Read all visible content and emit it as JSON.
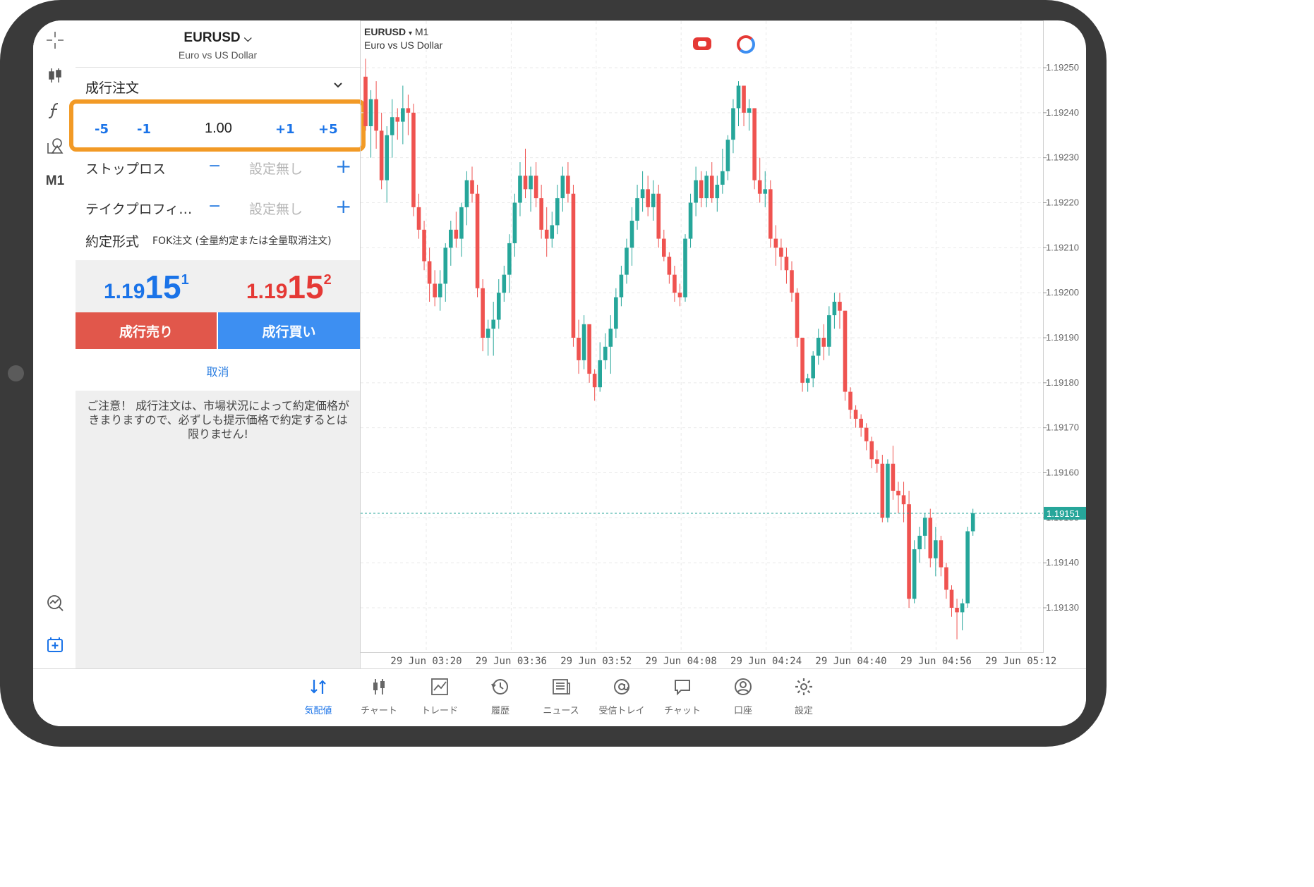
{
  "symbol": {
    "name": "EURUSD",
    "description": "Euro vs US Dollar"
  },
  "order": {
    "type": "成行注文",
    "volume": {
      "value": "1.00",
      "minus5": "-5",
      "minus1": "-1",
      "plus1": "+1",
      "plus5": "+5"
    },
    "stop_loss": {
      "label": "ストップロス",
      "minus": "−",
      "value": "設定無し",
      "plus": "+"
    },
    "take_profit": {
      "label": "テイクプロフィ…",
      "minus": "−",
      "value": "設定無し",
      "plus": "+"
    },
    "execution": {
      "label": "約定形式",
      "value": "FOK注文 (全量約定または全量取消注文)"
    },
    "bid": {
      "small": "1.19",
      "big": "15",
      "sup": "1"
    },
    "ask": {
      "small": "1.19",
      "big": "15",
      "sup": "2"
    },
    "sell_label": "成行売り",
    "buy_label": "成行買い",
    "cancel_label": "取消",
    "warning": "ご注意！ 成行注文は、市場状況によって約定価格がきまりますので、必ずしも提示価格で約定するとは限りません!"
  },
  "toolbar": {
    "timeframe": "M1"
  },
  "chart_header": {
    "symbol": "EURUSD",
    "arrow": "▾",
    "timeframe": "M1",
    "description": "Euro vs US Dollar"
  },
  "chart_data": {
    "type": "candlestick",
    "symbol": "EURUSD",
    "timeframe": "M1",
    "current_price": 1.19151,
    "current_price_label": "1.19151",
    "ylim": [
      1.19125,
      1.19253
    ],
    "y_ticks": [
      "1.19250",
      "1.19240",
      "1.19230",
      "1.19220",
      "1.19210",
      "1.19200",
      "1.19190",
      "1.19180",
      "1.19170",
      "1.19160",
      "1.19150",
      "1.19140",
      "1.19130"
    ],
    "x_ticks": [
      "29 Jun 03:20",
      "29 Jun 03:36",
      "29 Jun 03:52",
      "29 Jun 04:08",
      "29 Jun 04:24",
      "29 Jun 04:40",
      "29 Jun 04:56",
      "29 Jun 05:12"
    ],
    "grid": true,
    "colors": {
      "up": "#26a69a",
      "down": "#ef5350",
      "price_line": "#26a69a"
    },
    "ohlc": [
      [
        1.19248,
        1.19252,
        1.19236,
        1.19237
      ],
      [
        1.19237,
        1.19245,
        1.1923,
        1.19243
      ],
      [
        1.19243,
        1.19247,
        1.19232,
        1.19236
      ],
      [
        1.19236,
        1.1924,
        1.19223,
        1.19225
      ],
      [
        1.19225,
        1.19237,
        1.1922,
        1.19235
      ],
      [
        1.19235,
        1.19243,
        1.1923,
        1.19239
      ],
      [
        1.19239,
        1.19241,
        1.19234,
        1.19238
      ],
      [
        1.19238,
        1.19246,
        1.19233,
        1.19241
      ],
      [
        1.19241,
        1.19244,
        1.19235,
        1.1924
      ],
      [
        1.1924,
        1.19242,
        1.19217,
        1.19219
      ],
      [
        1.19219,
        1.19222,
        1.19212,
        1.19214
      ],
      [
        1.19214,
        1.19216,
        1.19205,
        1.19207
      ],
      [
        1.19207,
        1.1921,
        1.19198,
        1.19202
      ],
      [
        1.19202,
        1.19205,
        1.19197,
        1.19199
      ],
      [
        1.19199,
        1.19205,
        1.19196,
        1.19202
      ],
      [
        1.19202,
        1.19211,
        1.19198,
        1.1921
      ],
      [
        1.1921,
        1.19216,
        1.19206,
        1.19214
      ],
      [
        1.19214,
        1.19218,
        1.1921,
        1.19212
      ],
      [
        1.19212,
        1.1922,
        1.19208,
        1.19219
      ],
      [
        1.19219,
        1.19227,
        1.19215,
        1.19225
      ],
      [
        1.19225,
        1.19228,
        1.1922,
        1.19222
      ],
      [
        1.19222,
        1.19224,
        1.19199,
        1.19201
      ],
      [
        1.19201,
        1.19203,
        1.19187,
        1.1919
      ],
      [
        1.1919,
        1.19194,
        1.19186,
        1.19192
      ],
      [
        1.19192,
        1.19198,
        1.19186,
        1.19194
      ],
      [
        1.19194,
        1.19203,
        1.19192,
        1.192
      ],
      [
        1.192,
        1.19206,
        1.19198,
        1.19204
      ],
      [
        1.19204,
        1.19213,
        1.192,
        1.19211
      ],
      [
        1.19211,
        1.19222,
        1.19208,
        1.1922
      ],
      [
        1.1922,
        1.19229,
        1.19217,
        1.19226
      ],
      [
        1.19226,
        1.19232,
        1.19221,
        1.19223
      ],
      [
        1.19223,
        1.19228,
        1.19218,
        1.19226
      ],
      [
        1.19226,
        1.19229,
        1.19219,
        1.19221
      ],
      [
        1.19221,
        1.19224,
        1.19212,
        1.19214
      ],
      [
        1.19214,
        1.19219,
        1.19208,
        1.19212
      ],
      [
        1.19212,
        1.19218,
        1.1921,
        1.19215
      ],
      [
        1.19215,
        1.19224,
        1.19213,
        1.19221
      ],
      [
        1.19221,
        1.19228,
        1.19218,
        1.19226
      ],
      [
        1.19226,
        1.19229,
        1.1922,
        1.19222
      ],
      [
        1.19222,
        1.19224,
        1.19188,
        1.1919
      ],
      [
        1.1919,
        1.19194,
        1.19182,
        1.19185
      ],
      [
        1.19185,
        1.19195,
        1.19183,
        1.19193
      ],
      [
        1.19193,
        1.19193,
        1.1918,
        1.19182
      ],
      [
        1.19182,
        1.19183,
        1.19176,
        1.19179
      ],
      [
        1.19179,
        1.19189,
        1.19178,
        1.19185
      ],
      [
        1.19185,
        1.19191,
        1.19183,
        1.19188
      ],
      [
        1.19188,
        1.19195,
        1.19182,
        1.19192
      ],
      [
        1.19192,
        1.19201,
        1.1919,
        1.19199
      ],
      [
        1.19199,
        1.19206,
        1.19197,
        1.19204
      ],
      [
        1.19204,
        1.19212,
        1.19202,
        1.1921
      ],
      [
        1.1921,
        1.19219,
        1.19206,
        1.19216
      ],
      [
        1.19216,
        1.19224,
        1.19214,
        1.19221
      ],
      [
        1.19221,
        1.19227,
        1.19218,
        1.19223
      ],
      [
        1.19223,
        1.19226,
        1.19217,
        1.19219
      ],
      [
        1.19219,
        1.19225,
        1.19216,
        1.19222
      ],
      [
        1.19222,
        1.19224,
        1.1921,
        1.19212
      ],
      [
        1.19212,
        1.19214,
        1.19207,
        1.19208
      ],
      [
        1.19208,
        1.19209,
        1.19202,
        1.19204
      ],
      [
        1.19204,
        1.19206,
        1.19198,
        1.192
      ],
      [
        1.192,
        1.19202,
        1.19197,
        1.19199
      ],
      [
        1.19199,
        1.19213,
        1.19198,
        1.19212
      ],
      [
        1.19212,
        1.19222,
        1.1921,
        1.1922
      ],
      [
        1.1922,
        1.19228,
        1.19217,
        1.19225
      ],
      [
        1.19225,
        1.19227,
        1.19219,
        1.19221
      ],
      [
        1.19221,
        1.19227,
        1.19219,
        1.19226
      ],
      [
        1.19226,
        1.19229,
        1.1922,
        1.19221
      ],
      [
        1.19221,
        1.19226,
        1.19218,
        1.19224
      ],
      [
        1.19224,
        1.19232,
        1.19222,
        1.19227
      ],
      [
        1.19227,
        1.19235,
        1.19225,
        1.19234
      ],
      [
        1.19234,
        1.19243,
        1.19231,
        1.19241
      ],
      [
        1.19241,
        1.19247,
        1.19237,
        1.19246
      ],
      [
        1.19246,
        1.19246,
        1.19237,
        1.1924
      ],
      [
        1.1924,
        1.19243,
        1.19236,
        1.19241
      ],
      [
        1.19241,
        1.19241,
        1.19223,
        1.19225
      ],
      [
        1.19225,
        1.1923,
        1.1922,
        1.19222
      ],
      [
        1.19222,
        1.19227,
        1.19219,
        1.19223
      ],
      [
        1.19223,
        1.19225,
        1.1921,
        1.19212
      ],
      [
        1.19212,
        1.19215,
        1.19206,
        1.1921
      ],
      [
        1.1921,
        1.19212,
        1.19205,
        1.19208
      ],
      [
        1.19208,
        1.1921,
        1.19202,
        1.19205
      ],
      [
        1.19205,
        1.19207,
        1.19198,
        1.192
      ],
      [
        1.192,
        1.19201,
        1.19188,
        1.1919
      ],
      [
        1.1919,
        1.1919,
        1.19178,
        1.1918
      ],
      [
        1.1918,
        1.19182,
        1.19178,
        1.19181
      ],
      [
        1.19181,
        1.19187,
        1.19179,
        1.19186
      ],
      [
        1.19186,
        1.19192,
        1.19184,
        1.1919
      ],
      [
        1.1919,
        1.19193,
        1.19185,
        1.19188
      ],
      [
        1.19188,
        1.19197,
        1.19186,
        1.19195
      ],
      [
        1.19195,
        1.192,
        1.19192,
        1.19198
      ],
      [
        1.19198,
        1.192,
        1.19192,
        1.19196
      ],
      [
        1.19196,
        1.19196,
        1.19176,
        1.19178
      ],
      [
        1.19178,
        1.19179,
        1.19172,
        1.19174
      ],
      [
        1.19174,
        1.19175,
        1.1917,
        1.19172
      ],
      [
        1.19172,
        1.19173,
        1.19168,
        1.1917
      ],
      [
        1.1917,
        1.19171,
        1.19165,
        1.19167
      ],
      [
        1.19167,
        1.19168,
        1.19161,
        1.19163
      ],
      [
        1.19163,
        1.19165,
        1.1916,
        1.19162
      ],
      [
        1.19162,
        1.19164,
        1.19149,
        1.1915
      ],
      [
        1.1915,
        1.19163,
        1.19149,
        1.19162
      ],
      [
        1.19162,
        1.19166,
        1.19154,
        1.19156
      ],
      [
        1.19156,
        1.19158,
        1.19151,
        1.19155
      ],
      [
        1.19155,
        1.19158,
        1.19149,
        1.19153
      ],
      [
        1.19153,
        1.19156,
        1.1913,
        1.19132
      ],
      [
        1.19132,
        1.19145,
        1.19131,
        1.19143
      ],
      [
        1.19143,
        1.19148,
        1.1914,
        1.19146
      ],
      [
        1.19146,
        1.19151,
        1.19143,
        1.1915
      ],
      [
        1.1915,
        1.19152,
        1.19139,
        1.19141
      ],
      [
        1.19141,
        1.19148,
        1.19137,
        1.19145
      ],
      [
        1.19145,
        1.19146,
        1.19137,
        1.19139
      ],
      [
        1.19139,
        1.1914,
        1.19132,
        1.19134
      ],
      [
        1.19134,
        1.19135,
        1.19128,
        1.1913
      ],
      [
        1.1913,
        1.19132,
        1.19123,
        1.19129
      ],
      [
        1.19129,
        1.19132,
        1.19125,
        1.19131
      ],
      [
        1.19131,
        1.19148,
        1.1913,
        1.19147
      ],
      [
        1.19147,
        1.19152,
        1.19146,
        1.19151
      ]
    ]
  },
  "tabs": [
    {
      "label": "気配値",
      "icon": "quotes-icon",
      "active": true
    },
    {
      "label": "チャート",
      "icon": "chart-icon"
    },
    {
      "label": "トレード",
      "icon": "trade-icon"
    },
    {
      "label": "履歴",
      "icon": "history-icon"
    },
    {
      "label": "ニュース",
      "icon": "news-icon"
    },
    {
      "label": "受信トレイ",
      "icon": "mailbox-icon"
    },
    {
      "label": "チャット",
      "icon": "chat-icon"
    },
    {
      "label": "口座",
      "icon": "account-icon"
    },
    {
      "label": "設定",
      "icon": "settings-icon"
    }
  ],
  "colors": {
    "sell": "#e1574b",
    "buy": "#3d8ff2",
    "highlight": "#f29a26",
    "accent": "#1a73e8"
  }
}
